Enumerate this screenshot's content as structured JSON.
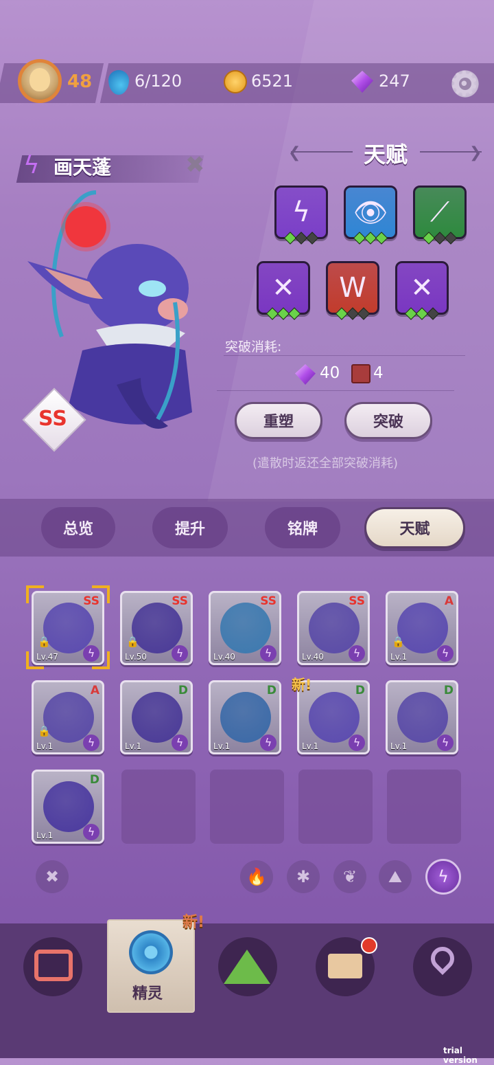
{
  "player": {
    "level": "48"
  },
  "resources": {
    "stamina": "6/120",
    "coins": "6521",
    "gems": "247"
  },
  "pet": {
    "name": "画天蓬",
    "rank": "SS"
  },
  "talent": {
    "title": "天赋",
    "icons": [
      {
        "name": "lightning-strike-icon",
        "color": "#7b3fc8",
        "glyph": "ϟ",
        "dots": [
          1,
          0,
          0
        ]
      },
      {
        "name": "eye-icon",
        "color": "#2f86d4",
        "glyph": "👁",
        "dots": [
          1,
          1,
          1
        ]
      },
      {
        "name": "claw-slash-icon",
        "color": "#2e8a3e",
        "glyph": "⟋",
        "dots": [
          1,
          0,
          0
        ]
      },
      {
        "name": "purple-slash-icon",
        "color": "#7a37c2",
        "glyph": "✕",
        "dots": [
          1,
          1,
          1
        ]
      },
      {
        "name": "fang-icon",
        "color": "#c23c2c",
        "glyph": "W",
        "dots": [
          1,
          0,
          0
        ]
      },
      {
        "name": "purple-slash-icon",
        "color": "#7a37c2",
        "glyph": "✕",
        "dots": [
          1,
          1,
          0
        ]
      }
    ]
  },
  "breakthrough": {
    "label": "突破消耗:",
    "gem_cost": "40",
    "book_cost": "4"
  },
  "buttons": {
    "reshape": "重塑",
    "breakthrough": "突破"
  },
  "note": "(遣散时返还全部突破消耗)",
  "tabs": [
    "总览",
    "提升",
    "铭牌",
    "天赋"
  ],
  "active_tab": "天赋",
  "pets": [
    {
      "rank": "SS",
      "level": "Lv.47",
      "locked": true,
      "color": "#5b4bb0",
      "rank_color": "#e8342e"
    },
    {
      "rank": "SS",
      "level": "Lv.50",
      "locked": true,
      "color": "#4a3a98",
      "rank_color": "#e8342e"
    },
    {
      "rank": "SS",
      "level": "Lv.40",
      "locked": false,
      "color": "#3c7ab0",
      "rank_color": "#e8342e"
    },
    {
      "rank": "SS",
      "level": "Lv.40",
      "locked": false,
      "color": "#5a4ba8",
      "rank_color": "#e8342e"
    },
    {
      "rank": "A",
      "level": "Lv.1",
      "locked": true,
      "color": "#5b4bb0",
      "rank_color": "#d83a3a"
    },
    {
      "rank": "A",
      "level": "Lv.1",
      "locked": true,
      "color": "#5a4ba8",
      "rank_color": "#d83a3a"
    },
    {
      "rank": "D",
      "level": "Lv.1",
      "locked": false,
      "color": "#4a3a98",
      "rank_color": "#3a8a3a"
    },
    {
      "rank": "D",
      "level": "Lv.1",
      "locked": false,
      "color": "#3a6aa8",
      "rank_color": "#3a8a3a"
    },
    {
      "rank": "D",
      "level": "Lv.1",
      "locked": false,
      "color": "#5b4bb0",
      "rank_color": "#3a8a3a",
      "new": "新!"
    },
    {
      "rank": "D",
      "level": "Lv.1",
      "locked": false,
      "color": "#5a4ba8",
      "rank_color": "#3a8a3a"
    },
    {
      "rank": "D",
      "level": "Lv.1",
      "locked": false,
      "color": "#4b3aa0",
      "rank_color": "#3a8a3a"
    }
  ],
  "filters": [
    "fire-icon",
    "snowflake-icon",
    "leaf-icon",
    "rock-icon",
    "lightning-icon"
  ],
  "nav": {
    "active_label": "精灵",
    "new_tag": "新!"
  },
  "watermark": "trial version"
}
